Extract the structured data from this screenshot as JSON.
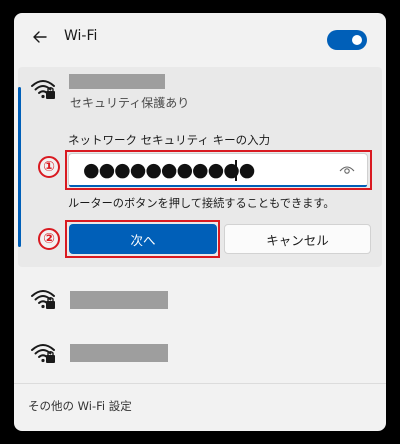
{
  "header": {
    "title": "Wi-Fi",
    "back_icon": "back-arrow-icon",
    "toggle_on": true,
    "accent": "#005fb8"
  },
  "connecting_network": {
    "status": "セキュリティ保護あり",
    "icon": "wifi-secured-icon",
    "password_label": "ネットワーク セキュリティ キーの入力",
    "password_value": "●●●●●●●●●●●",
    "reveal_icon": "eye-icon",
    "hint": "ルーターのボタンを押して接続することもできます。",
    "next_label": "次へ",
    "cancel_label": "キャンセル"
  },
  "callouts": {
    "step1": "①",
    "step2": "②",
    "color": "#d91a21"
  },
  "other_networks": [
    {
      "icon": "wifi-secured-icon"
    },
    {
      "icon": "wifi-secured-icon"
    }
  ],
  "footer": {
    "more_settings": "その他の Wi-Fi 設定"
  }
}
